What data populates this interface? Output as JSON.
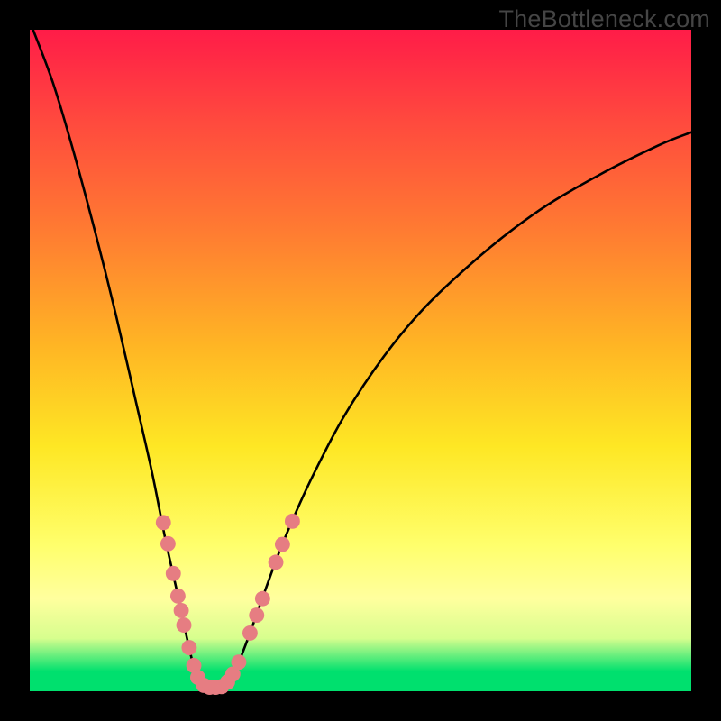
{
  "watermark": "TheBottleneck.com",
  "chart_data": {
    "type": "line",
    "title": "",
    "xlabel": "",
    "ylabel": "",
    "xlim": [
      0,
      100
    ],
    "ylim": [
      0,
      100
    ],
    "curve": {
      "description": "V-shaped bottleneck curve, two branches meeting at a flat minimum",
      "left_branch": [
        {
          "x": 0.5,
          "y": 100
        },
        {
          "x": 3.5,
          "y": 92
        },
        {
          "x": 6.5,
          "y": 82
        },
        {
          "x": 10,
          "y": 69
        },
        {
          "x": 13,
          "y": 57
        },
        {
          "x": 16,
          "y": 44
        },
        {
          "x": 18.5,
          "y": 33
        },
        {
          "x": 20.5,
          "y": 23
        },
        {
          "x": 22.5,
          "y": 14
        },
        {
          "x": 24,
          "y": 7
        },
        {
          "x": 25.3,
          "y": 2
        },
        {
          "x": 26.5,
          "y": 0.6
        }
      ],
      "right_branch": [
        {
          "x": 29.5,
          "y": 0.6
        },
        {
          "x": 31,
          "y": 3
        },
        {
          "x": 33,
          "y": 8
        },
        {
          "x": 35.5,
          "y": 15
        },
        {
          "x": 38.5,
          "y": 23
        },
        {
          "x": 43,
          "y": 33
        },
        {
          "x": 49,
          "y": 44
        },
        {
          "x": 57,
          "y": 55
        },
        {
          "x": 66,
          "y": 64
        },
        {
          "x": 76,
          "y": 72
        },
        {
          "x": 86,
          "y": 78
        },
        {
          "x": 95,
          "y": 82.5
        },
        {
          "x": 100,
          "y": 84.5
        }
      ]
    },
    "markers": {
      "color": "#e67d82",
      "radius_pct": 1.15,
      "points": [
        {
          "x": 20.2,
          "y": 25.5
        },
        {
          "x": 20.9,
          "y": 22.3
        },
        {
          "x": 21.7,
          "y": 17.8
        },
        {
          "x": 22.4,
          "y": 14.4
        },
        {
          "x": 22.9,
          "y": 12.2
        },
        {
          "x": 23.3,
          "y": 10.0
        },
        {
          "x": 24.1,
          "y": 6.6
        },
        {
          "x": 24.8,
          "y": 3.9
        },
        {
          "x": 25.4,
          "y": 2.1
        },
        {
          "x": 26.3,
          "y": 0.9
        },
        {
          "x": 27.2,
          "y": 0.6
        },
        {
          "x": 28.1,
          "y": 0.6
        },
        {
          "x": 29.0,
          "y": 0.7
        },
        {
          "x": 29.9,
          "y": 1.4
        },
        {
          "x": 30.7,
          "y": 2.6
        },
        {
          "x": 31.6,
          "y": 4.4
        },
        {
          "x": 33.3,
          "y": 8.8
        },
        {
          "x": 34.3,
          "y": 11.5
        },
        {
          "x": 35.2,
          "y": 14.0
        },
        {
          "x": 37.2,
          "y": 19.5
        },
        {
          "x": 38.2,
          "y": 22.2
        },
        {
          "x": 39.7,
          "y": 25.7
        }
      ]
    }
  }
}
